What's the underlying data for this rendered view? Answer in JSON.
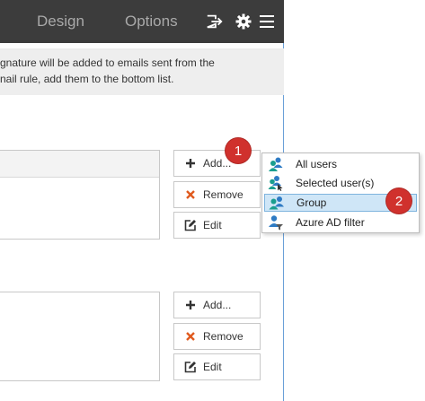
{
  "titlebar": {
    "tabs": [
      {
        "label": "Design"
      },
      {
        "label": "Options"
      }
    ],
    "icons": {
      "exit": "exit-icon",
      "settings": "gear-icon",
      "menu": "hamburger-menu-icon"
    }
  },
  "info": {
    "line1": "gnature will be added to emails sent from the",
    "line2": "nail rule, add them to the bottom list."
  },
  "top_list": {
    "add_label": "Add...",
    "remove_label": "Remove",
    "edit_label": "Edit"
  },
  "bottom_list": {
    "add_label": "Add...",
    "remove_label": "Remove",
    "edit_label": "Edit"
  },
  "dropdown": {
    "items": [
      {
        "label": "All users",
        "icon": "users-icon"
      },
      {
        "label": "Selected user(s)",
        "icon": "users-cursor-icon"
      },
      {
        "label": "Group",
        "icon": "group-icon",
        "highlighted": true
      },
      {
        "label": "Azure AD filter",
        "icon": "user-filter-icon"
      }
    ]
  },
  "callouts": {
    "first": "1",
    "second": "2"
  },
  "colors": {
    "titlebar": "#3c3c3c",
    "badge": "#d0312d",
    "highlight": "#cfe6f7",
    "add_icon": "#333333",
    "remove_icon": "#e05a1e",
    "user_icon_blue": "#2e7bc4",
    "user_icon_teal": "#1a9e8f"
  }
}
